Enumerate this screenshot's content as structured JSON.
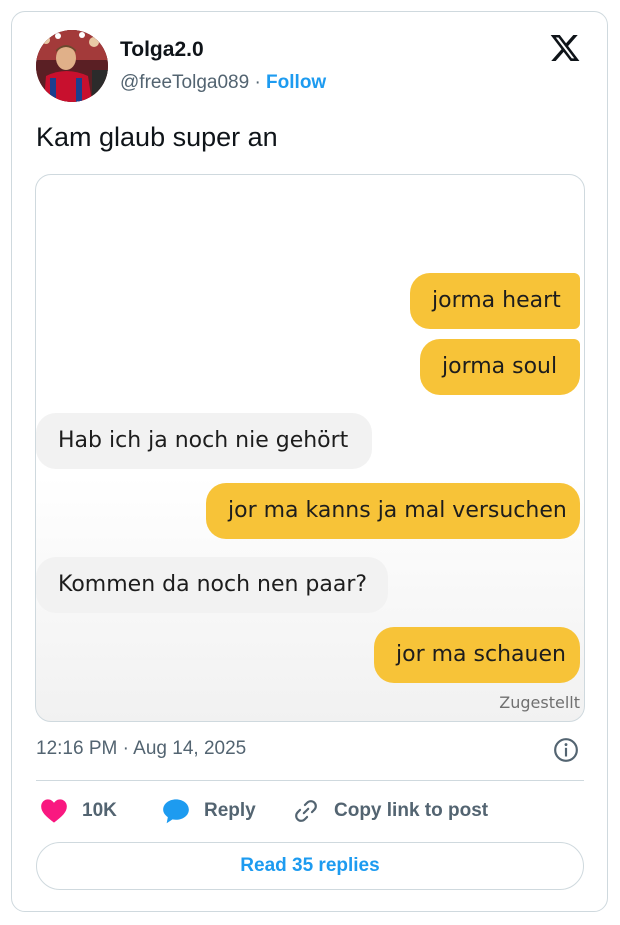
{
  "author": {
    "display_name": "Tolga2.0",
    "handle": "@freeTolga089",
    "separator": "·",
    "follow_label": "Follow"
  },
  "tweet": {
    "text": "Kam glaub super an",
    "timestamp": "12:16 PM · Aug 14, 2025"
  },
  "chat": {
    "messages": [
      {
        "direction": "outgoing",
        "text": "jorma heart"
      },
      {
        "direction": "outgoing",
        "text": "jorma soul"
      },
      {
        "direction": "incoming",
        "text": "Hab ich ja noch nie gehört"
      },
      {
        "direction": "outgoing",
        "text": "jor ma kanns ja mal versuchen"
      },
      {
        "direction": "incoming",
        "text": "Kommen da noch nen paar?"
      },
      {
        "direction": "outgoing",
        "text": "jor ma schauen"
      }
    ],
    "status": "Zugestellt",
    "colors": {
      "outgoing_bubble": "#f7c338",
      "incoming_bubble": "#f2f2f2"
    }
  },
  "actions": {
    "likes_count": "10K",
    "reply_label": "Reply",
    "copy_link_label": "Copy link to post",
    "read_replies_label": "Read 35 replies"
  },
  "icons": [
    "x-logo-icon",
    "info-icon",
    "heart-icon",
    "reply-bubble-icon",
    "link-icon"
  ],
  "colors": {
    "accent": "#1d9bf0",
    "like": "#f91880",
    "text_secondary": "#536471"
  }
}
